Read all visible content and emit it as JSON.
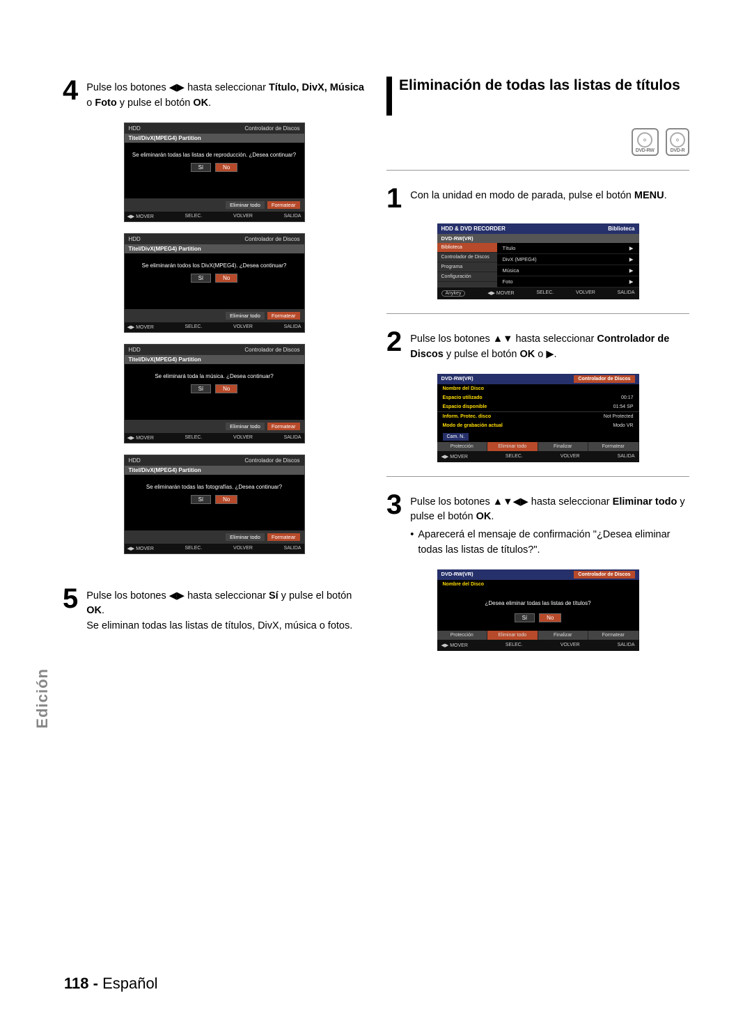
{
  "side_tab": "Edición",
  "footer": {
    "page": "118 -",
    "lang": "Español"
  },
  "left": {
    "step4": {
      "num": "4",
      "p1": "Pulse los botones ◀▶ hasta seleccionar ",
      "p1b": "Título, DivX, Música",
      "p2": " o ",
      "p2b": "Foto",
      "p3": " y pulse el botón ",
      "p3b": "OK",
      "p4": "."
    },
    "step5": {
      "num": "5",
      "l1a": "Pulse los botones ◀▶ hasta seleccionar ",
      "l1b": "Sí",
      "l1c": " y pulse el botón ",
      "l1d": "OK",
      "l1e": ".",
      "l2": "Se eliminan todas las listas de títulos, DivX, música o fotos."
    },
    "mock_common": {
      "hdr_left": "HDD",
      "hdr_right": "Controlador de Discos",
      "band": "Titel/DivX(MPEG4) Partition",
      "si": "Sí",
      "no": "No",
      "del_all": "Eliminar todo",
      "format": "Formatear",
      "f_mover": "◀▶ MOVER",
      "f_sel": "SELEC.",
      "f_vol": "VOLVER",
      "f_sal": "SALIDA"
    },
    "mock_msgs": [
      "Se eliminarán todas las listas de reproducción. ¿Desea continuar?",
      "Se eliminarán todos los DivX(MPEG4). ¿Desea continuar?",
      "Se eliminará toda la música. ¿Desea continuar?",
      "Se eliminarán todas las fotografías. ¿Desea continuar?"
    ]
  },
  "right": {
    "heading": "Eliminación de todas las listas de títulos",
    "disc1": "DVD-RW",
    "disc2": "DVD-R",
    "step1": {
      "num": "1",
      "a": "Con la unidad en modo de parada, pulse el botón ",
      "b": "MENU",
      "c": "."
    },
    "step2": {
      "num": "2",
      "a": "Pulse los botones ▲▼ hasta seleccionar ",
      "b": "Controlador de Discos",
      "c": " y pulse el botón ",
      "d": "OK",
      "e": " o ▶."
    },
    "step3": {
      "num": "3",
      "a": "Pulse los botones ▲▼◀▶ hasta seleccionar ",
      "b": "Eliminar todo",
      "c": " y pulse el botón ",
      "d": "OK",
      "e": ".",
      "bullet": "Aparecerá el mensaje de confirmación \"¿Desea eliminar todas las listas de títulos?\"."
    },
    "mockA": {
      "top_l": "HDD & DVD RECORDER",
      "top_r": "Biblioteca",
      "sub": "DVD-RW(VR)",
      "side": [
        "Biblioteca",
        "Controlador de Discos",
        "Programa",
        "Configuración"
      ],
      "main": [
        {
          "l": "Título",
          "r": "▶"
        },
        {
          "l": "DivX (MPEG4)",
          "r": "▶"
        },
        {
          "l": "Música",
          "r": "▶"
        },
        {
          "l": "Foto",
          "r": "▶"
        }
      ],
      "foot": [
        "◀▶ MOVER",
        "SELEC.",
        "VOLVER",
        "SALIDA"
      ],
      "anykey": "Anykey"
    },
    "mockB": {
      "sub": "DVD-RW(VR)",
      "sub_r": "Controlador de Discos",
      "rows": [
        {
          "l": "Nombre del Disco",
          "r": ""
        },
        {
          "l": "Espacio utilizado",
          "r": "00:17"
        },
        {
          "l": "Espacio disponible",
          "r": "01:54 SP"
        },
        {
          "l": "Inform. Protec. disco",
          "r": "Not Protected"
        },
        {
          "l": "Modo de grabación actual",
          "r": "Modo VR"
        }
      ],
      "camn": "Cam. N.",
      "tabs": [
        "Protección",
        "Eliminar todo",
        "Finalizar",
        "Formatear"
      ],
      "foot": [
        "◀▶ MOVER",
        "SELEC.",
        "VOLVER",
        "SALIDA"
      ]
    },
    "mockC": {
      "sub": "DVD-RW(VR)",
      "sub_r": "Controlador de Discos",
      "row1": "Nombre del Disco",
      "dialog": "¿Desea eliminar todas las listas de títulos?",
      "si": "Sí",
      "no": "No",
      "tabs": [
        "Protección",
        "Eliminar todo",
        "Finalizar",
        "Formatear"
      ],
      "foot": [
        "◀▶ MOVER",
        "SELEC.",
        "VOLVER",
        "SALIDA"
      ]
    }
  }
}
